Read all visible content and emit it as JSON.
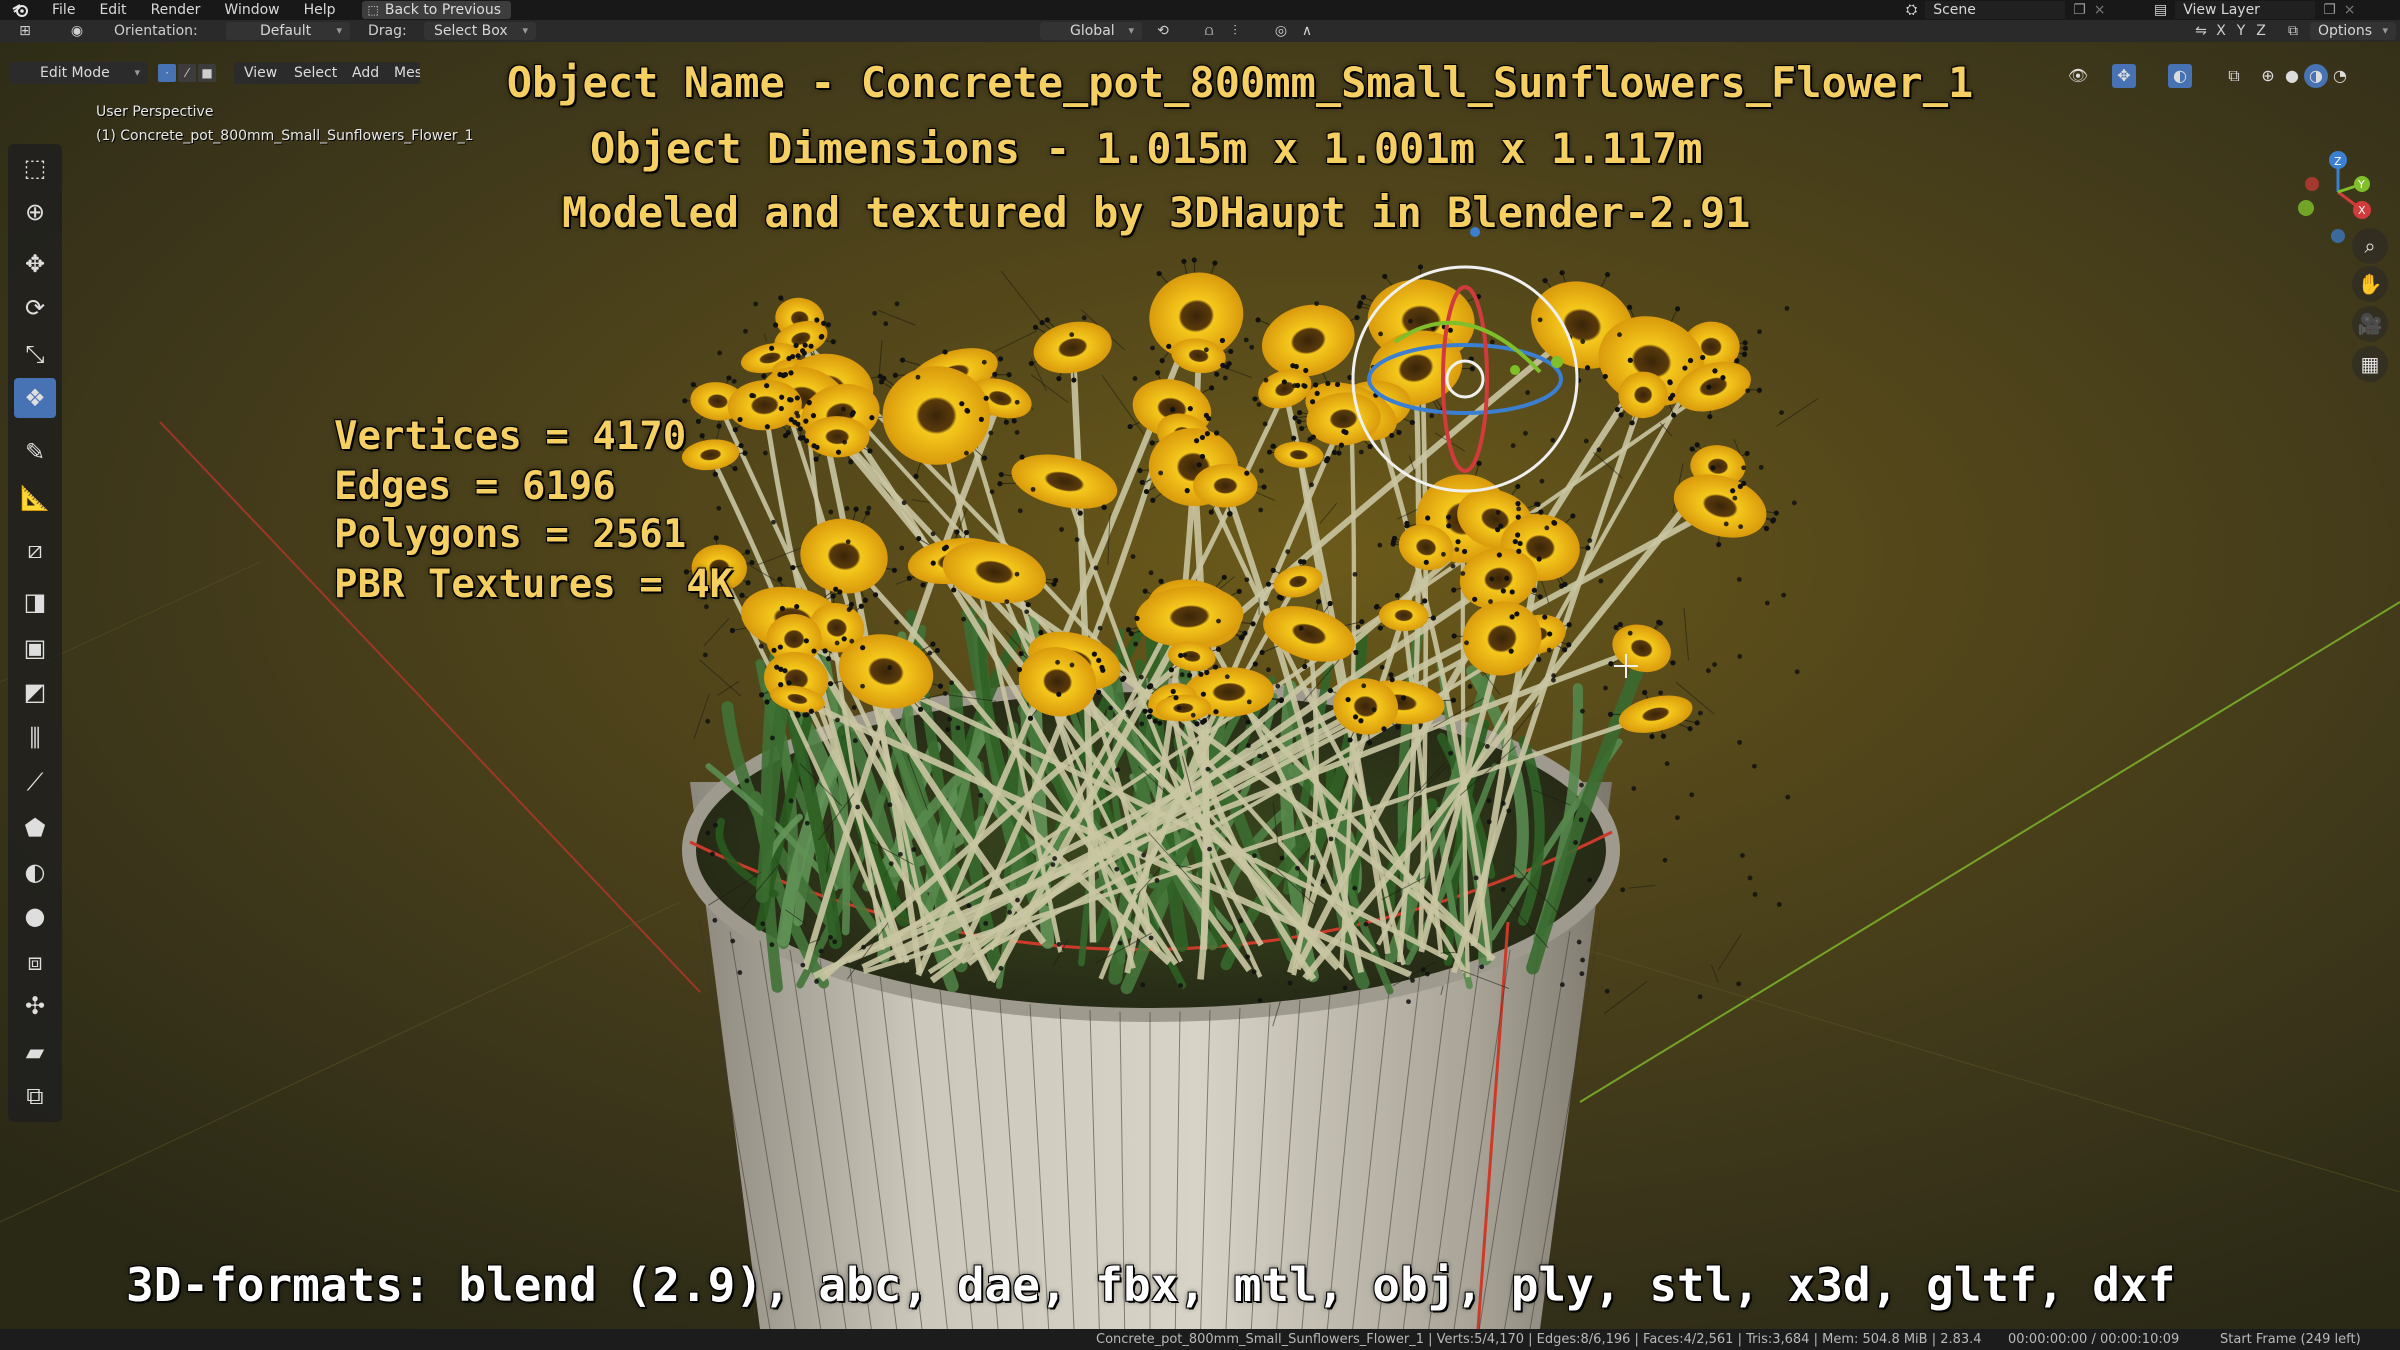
{
  "menubar": {
    "items": [
      "File",
      "Edit",
      "Render",
      "Window",
      "Help"
    ],
    "back_button": "Back to Previous",
    "scene": "Scene",
    "view_layer": "View Layer"
  },
  "header": {
    "orientation_label": "Orientation:",
    "orientation_value": "Default",
    "drag_label": "Drag:",
    "drag_value": "Select Box",
    "transform_orientation": "Global",
    "axes": [
      "X",
      "Y",
      "Z"
    ],
    "options": "Options"
  },
  "viewport_header": {
    "mode": "Edit Mode",
    "menus": [
      "View",
      "Select",
      "Add",
      "Mesh"
    ]
  },
  "viewport": {
    "perspective_label": "User Perspective",
    "object_label": "(1) Concrete_pot_800mm_Small_Sunflowers_Flower_1",
    "gizmo_axes": [
      "X",
      "Y",
      "Z"
    ]
  },
  "overlay": {
    "object_name": "Object Name - Concrete_pot_800mm_Small_Sunflowers_Flower_1",
    "dimensions": "Object Dimensions -  1.015m x 1.001m x 1.117m",
    "credit": "Modeled and textured by 3DHaupt in Blender-2.91",
    "stats": [
      "Vertices = 4170",
      "Edges = 6196",
      "Polygons = 2561",
      "PBR Textures = 4K"
    ],
    "formats": "3D-formats: blend (2.9), abc, dae, fbx, mtl, obj, ply, stl, x3d, gltf, dxf"
  },
  "statusbar": {
    "stats": "Concrete_pot_800mm_Small_Sunflowers_Flower_1 | Verts:5/4,170 | Edges:8/6,196 | Faces:4/2,561 | Tris:3,684 | Mem: 504.8 MiB | 2.83.4",
    "time": "00:00:00:00 / 00:00:10:09",
    "frame": "Start Frame (249 left)"
  },
  "colors": {
    "overlay_text": "#f6cf63",
    "active_tool": "#4772b3",
    "x_axis": "#d23b3b",
    "y_axis": "#7fbf2a",
    "z_axis": "#3b7fd2"
  },
  "icons": [
    "blender-logo-icon",
    "editor-type-icon",
    "cursor-select-icon",
    "move-icon",
    "rotate-icon",
    "scale-icon",
    "transform-icon",
    "annotate-icon",
    "measure-icon",
    "zoom-icon",
    "hand-pan-icon",
    "camera-icon",
    "grid-icon"
  ]
}
